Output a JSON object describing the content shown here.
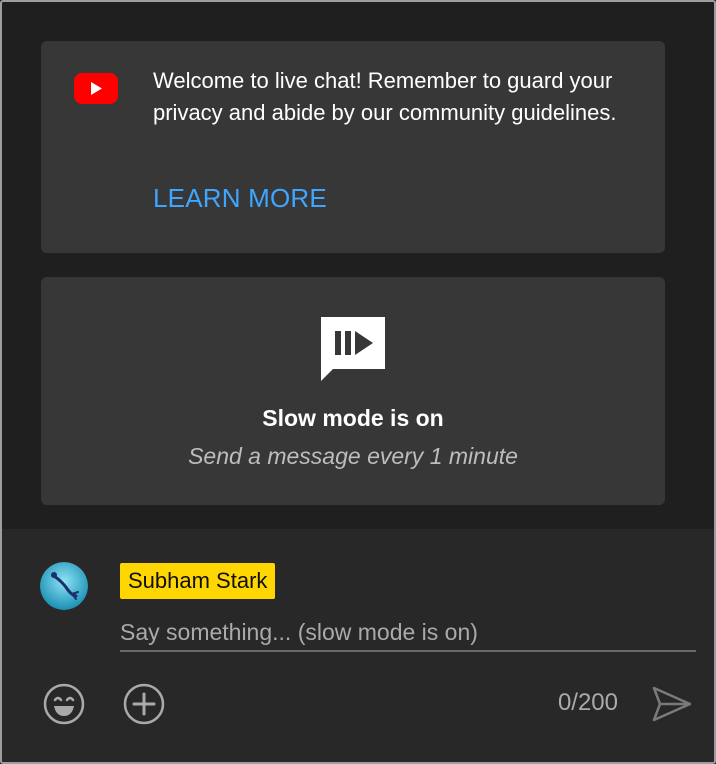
{
  "welcome": {
    "message": "Welcome to live chat! Remember to guard your privacy and abide by our community guidelines.",
    "learn_more": "LEARN MORE",
    "logo_icon": "youtube-logo-icon"
  },
  "slow_mode": {
    "icon": "slow-mode-icon",
    "title": "Slow mode is on",
    "subtitle": "Send a message every 1 minute"
  },
  "composer": {
    "username": "Subham Stark",
    "placeholder": "Say something... (slow mode is on)",
    "value": "",
    "counter": "0/200",
    "emoji_icon": "emoji-icon",
    "plus_icon": "add-icon",
    "send_icon": "send-icon"
  },
  "colors": {
    "background": "#1f1f1f",
    "card": "#373737",
    "composer": "#282828",
    "link": "#3ea6ff",
    "username_badge": "#ffd600",
    "youtube_red": "#ff0000"
  }
}
